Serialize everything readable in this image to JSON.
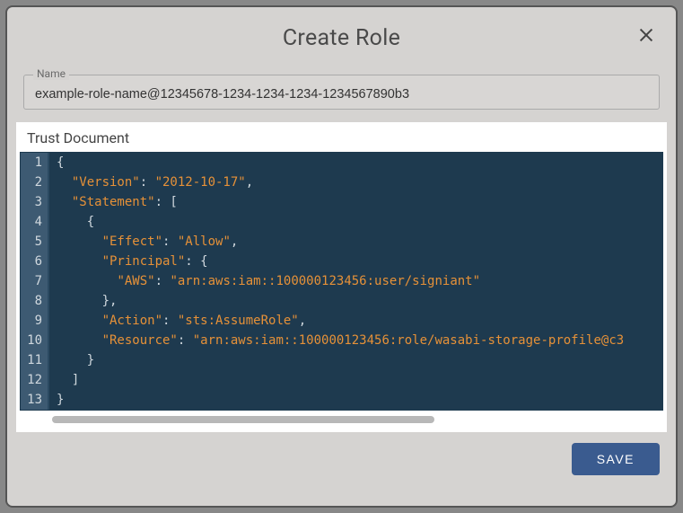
{
  "modal": {
    "title": "Create Role",
    "close_icon": "close-icon",
    "name_field": {
      "label": "Name",
      "value": "example-role-name@12345678-1234-1234-1234-1234567890b3"
    },
    "trust_doc": {
      "heading": "Trust Document",
      "line_count": 13,
      "lines": [
        {
          "n": 1,
          "indent": 0,
          "tokens": [
            {
              "t": "brace",
              "v": "{"
            }
          ]
        },
        {
          "n": 2,
          "indent": 1,
          "tokens": [
            {
              "t": "key",
              "v": "\"Version\""
            },
            {
              "t": "punc",
              "v": ": "
            },
            {
              "t": "str",
              "v": "\"2012-10-17\""
            },
            {
              "t": "punc",
              "v": ","
            }
          ]
        },
        {
          "n": 3,
          "indent": 1,
          "tokens": [
            {
              "t": "key",
              "v": "\"Statement\""
            },
            {
              "t": "punc",
              "v": ": ["
            }
          ]
        },
        {
          "n": 4,
          "indent": 2,
          "tokens": [
            {
              "t": "brace",
              "v": "{"
            }
          ]
        },
        {
          "n": 5,
          "indent": 3,
          "tokens": [
            {
              "t": "key",
              "v": "\"Effect\""
            },
            {
              "t": "punc",
              "v": ": "
            },
            {
              "t": "str",
              "v": "\"Allow\""
            },
            {
              "t": "punc",
              "v": ","
            }
          ]
        },
        {
          "n": 6,
          "indent": 3,
          "tokens": [
            {
              "t": "key",
              "v": "\"Principal\""
            },
            {
              "t": "punc",
              "v": ": {"
            }
          ]
        },
        {
          "n": 7,
          "indent": 4,
          "tokens": [
            {
              "t": "key",
              "v": "\"AWS\""
            },
            {
              "t": "punc",
              "v": ": "
            },
            {
              "t": "str",
              "v": "\"arn:aws:iam::100000123456:user/signiant\""
            }
          ]
        },
        {
          "n": 8,
          "indent": 3,
          "tokens": [
            {
              "t": "punc",
              "v": "},"
            }
          ]
        },
        {
          "n": 9,
          "indent": 3,
          "tokens": [
            {
              "t": "key",
              "v": "\"Action\""
            },
            {
              "t": "punc",
              "v": ": "
            },
            {
              "t": "str",
              "v": "\"sts:AssumeRole\""
            },
            {
              "t": "punc",
              "v": ","
            }
          ]
        },
        {
          "n": 10,
          "indent": 3,
          "tokens": [
            {
              "t": "key",
              "v": "\"Resource\""
            },
            {
              "t": "punc",
              "v": ": "
            },
            {
              "t": "str",
              "v": "\"arn:aws:iam::100000123456:role/wasabi-storage-profile@c3"
            }
          ]
        },
        {
          "n": 11,
          "indent": 2,
          "tokens": [
            {
              "t": "brace",
              "v": "}"
            }
          ]
        },
        {
          "n": 12,
          "indent": 1,
          "tokens": [
            {
              "t": "punc",
              "v": "]"
            }
          ]
        },
        {
          "n": 13,
          "indent": 0,
          "tokens": [
            {
              "t": "brace",
              "v": "}"
            }
          ]
        }
      ]
    },
    "save_label": "SAVE"
  }
}
